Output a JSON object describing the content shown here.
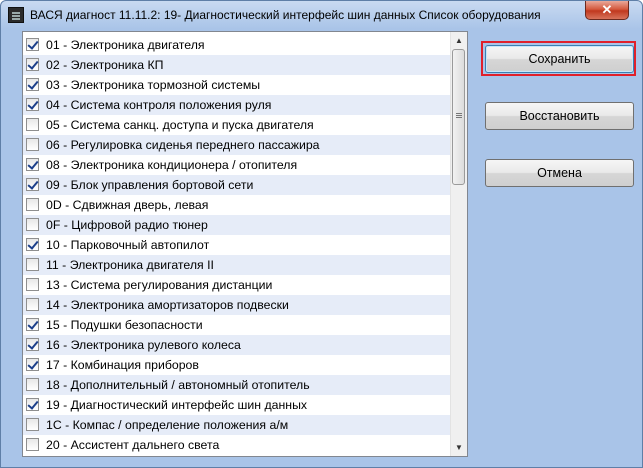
{
  "window": {
    "title": "ВАСЯ диагност 11.11.2: 19- Диагностический интерфейс шин данных Список оборудования",
    "close_glyph": "✕"
  },
  "list": {
    "items": [
      {
        "label": "01 -  Электроника двигателя",
        "checked": true
      },
      {
        "label": "02 -  Электроника КП",
        "checked": true
      },
      {
        "label": "03 -  Электроника тормозной системы",
        "checked": true
      },
      {
        "label": "04 -  Система контроля положения руля",
        "checked": true
      },
      {
        "label": "05 -  Система санкц. доступа и пуска двигателя",
        "checked": false
      },
      {
        "label": "06 -  Регулировка сиденья переднего пассажира",
        "checked": false
      },
      {
        "label": "08 -  Электроника кондиционера / отопителя",
        "checked": true
      },
      {
        "label": "09 -  Блок управления бортовой сети",
        "checked": true
      },
      {
        "label": "0D -  Сдвижная дверь, левая",
        "checked": false
      },
      {
        "label": "0F -  Цифровой радио тюнер",
        "checked": false
      },
      {
        "label": "10 -  Парковочный автопилот",
        "checked": true
      },
      {
        "label": "11 -  Электроника двигателя II",
        "checked": false
      },
      {
        "label": "13 -  Система регулирования дистанции",
        "checked": false
      },
      {
        "label": "14 -  Электроника амортизаторов подвески",
        "checked": false
      },
      {
        "label": "15 -  Подушки безопасности",
        "checked": true
      },
      {
        "label": "16 -  Электроника рулевого колеса",
        "checked": true
      },
      {
        "label": "17 -  Комбинация приборов",
        "checked": true
      },
      {
        "label": "18 -  Дополнительный / автономный отопитель",
        "checked": false
      },
      {
        "label": "19 -  Диагностический интерфейс шин данных",
        "checked": true
      },
      {
        "label": "1C -  Компас / определение положения а/м",
        "checked": false
      },
      {
        "label": "20 -  Ассистент дальнего света",
        "checked": false
      }
    ]
  },
  "buttons": {
    "save_label": "Сохранить",
    "restore_label": "Восстановить",
    "cancel_label": "Отмена"
  },
  "colors": {
    "window_bg": "#a9c4e8",
    "highlight": "#e0202a",
    "alt_row": "#e6ecf8"
  }
}
